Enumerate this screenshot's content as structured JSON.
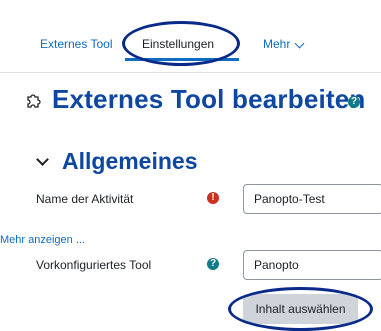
{
  "tabs": [
    {
      "label": "Externes Tool",
      "active": false
    },
    {
      "label": "Einstellungen",
      "active": true
    },
    {
      "label": "Mehr",
      "active": false
    }
  ],
  "page": {
    "title": "Externes Tool bearbeiten",
    "help_icon": "question-circle-icon"
  },
  "section": {
    "title": "Allgemeines"
  },
  "fields": {
    "activity_name": {
      "label": "Name der Aktivität",
      "value": "Panopto-Test",
      "icon": "required-exclamation-icon"
    },
    "show_more_link": "Mehr anzeigen ...",
    "preconfigured_tool": {
      "label": "Vorkonfiguriertes Tool",
      "value": "Panopto",
      "icon": "help-question-icon"
    }
  },
  "buttons": {
    "select_content": "Inhalt auswählen"
  },
  "colors": {
    "link": "#0f6cbf",
    "heading": "#0d47a1",
    "required": "#ca3120",
    "help": "#0f7a8a",
    "highlight": "#0a2a8a"
  }
}
